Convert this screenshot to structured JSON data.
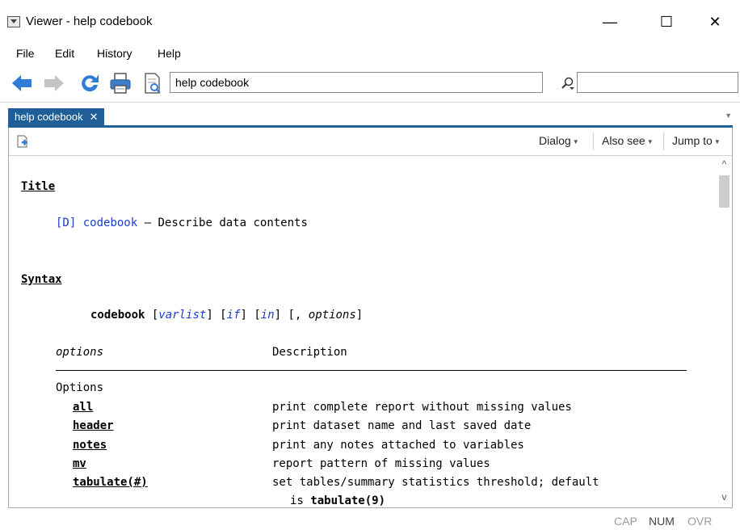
{
  "window": {
    "title": "Viewer - help codebook",
    "minimize": "—",
    "maximize": "☐",
    "close": "✕"
  },
  "menu": [
    "File",
    "Edit",
    "History",
    "Help"
  ],
  "toolbar": {
    "address": "help codebook"
  },
  "tab": {
    "label": "help codebook",
    "close": "✕"
  },
  "viewer_toolbar": {
    "dialog": "Dialog",
    "also_see": "Also see",
    "jump_to": "Jump to"
  },
  "content": {
    "title_header": "Title",
    "title_ref": "[D]",
    "title_cmd": "codebook",
    "title_desc": " — Describe data contents",
    "syntax_header": "Syntax",
    "syntax": {
      "cmd": "codebook",
      "p1": " [",
      "varlist": "varlist",
      "p2": "] [",
      "if": "if",
      "p3": "] [",
      "in": "in",
      "p4": "] [, ",
      "options": "options",
      "p5": "]"
    },
    "table_head_options": "options",
    "table_head_desc": "Description",
    "group": "Options",
    "rows": [
      {
        "opt": "all",
        "desc": "print complete report without missing values"
      },
      {
        "opt": "header",
        "desc": "print dataset name and last saved date"
      },
      {
        "opt": "notes",
        "desc": "print any notes attached to variables"
      },
      {
        "opt": "mv",
        "desc": "report pattern of missing values"
      },
      {
        "opt": "tabulate(#)",
        "desc": "set tables/summary statistics threshold; default"
      }
    ],
    "cont_prefix": "is ",
    "cont_value": "tabulate(9)"
  },
  "status": {
    "cap": "CAP",
    "num": "NUM",
    "ovr": "OVR"
  }
}
